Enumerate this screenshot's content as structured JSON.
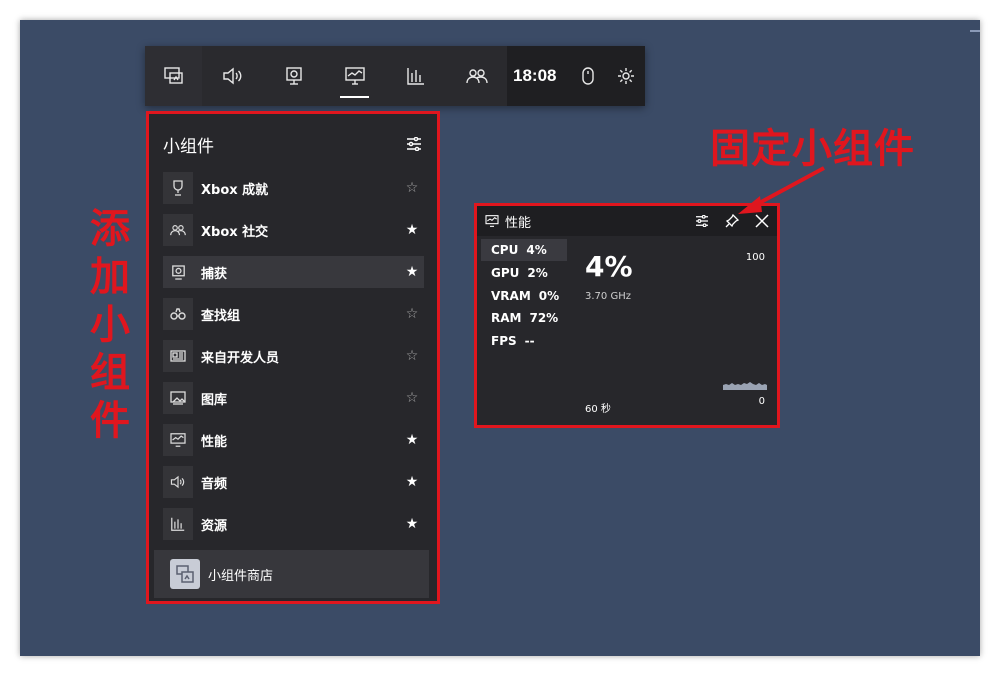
{
  "topbar": {
    "clock": "18:08",
    "buttons": [
      "widget-menu-icon",
      "audio-icon",
      "capture-icon",
      "performance-icon",
      "resources-icon",
      "social-icon"
    ]
  },
  "widget_menu": {
    "title": "小组件",
    "items": [
      {
        "label": "Xbox 成就",
        "icon": "trophy-icon",
        "pinned": false
      },
      {
        "label": "Xbox 社交",
        "icon": "social-icon",
        "pinned": true
      },
      {
        "label": "捕获",
        "icon": "capture-icon",
        "pinned": true
      },
      {
        "label": "查找组",
        "icon": "binoculars-icon",
        "pinned": false
      },
      {
        "label": "来自开发人员",
        "icon": "news-icon",
        "pinned": false
      },
      {
        "label": "图库",
        "icon": "gallery-icon",
        "pinned": false
      },
      {
        "label": "性能",
        "icon": "performance-icon",
        "pinned": true
      },
      {
        "label": "音频",
        "icon": "audio-icon",
        "pinned": true
      },
      {
        "label": "资源",
        "icon": "resources-icon",
        "pinned": true
      }
    ],
    "star_on": "★",
    "star_off": "☆",
    "store_label": "小组件商店"
  },
  "performance": {
    "title": "性能",
    "metrics": [
      {
        "name": "CPU",
        "value": "4%"
      },
      {
        "name": "GPU",
        "value": "2%"
      },
      {
        "name": "VRAM",
        "value": "0%"
      },
      {
        "name": "RAM",
        "value": "72%"
      },
      {
        "name": "FPS",
        "value": "--"
      }
    ],
    "big_value": "4%",
    "frequency": "3.70 GHz",
    "y_max": "100",
    "y_min": "0",
    "time_span": "60 秒"
  },
  "annotations": {
    "add_widget": [
      "添",
      "加",
      "小",
      "组",
      "件"
    ],
    "pin_widget": "固定小组件"
  },
  "colors": {
    "annotation_red": "#e0161e",
    "panel_bg": "#27272b",
    "desktop_bg": "#3b4b66"
  }
}
